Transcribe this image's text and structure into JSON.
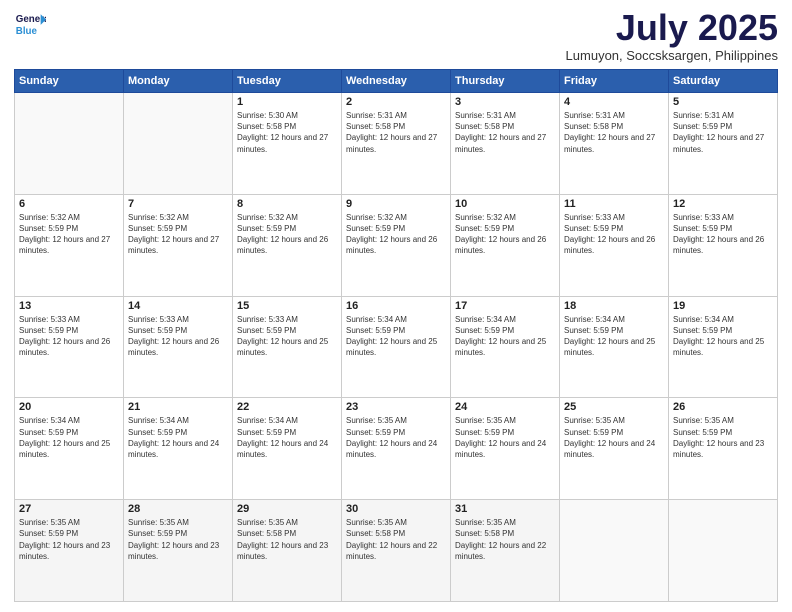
{
  "logo": {
    "line1": "General",
    "line2": "Blue"
  },
  "title": "July 2025",
  "location": "Lumuyon, Soccsksargen, Philippines",
  "days_header": [
    "Sunday",
    "Monday",
    "Tuesday",
    "Wednesday",
    "Thursday",
    "Friday",
    "Saturday"
  ],
  "weeks": [
    [
      {
        "day": "",
        "sunrise": "",
        "sunset": "",
        "daylight": ""
      },
      {
        "day": "",
        "sunrise": "",
        "sunset": "",
        "daylight": ""
      },
      {
        "day": "1",
        "sunrise": "Sunrise: 5:30 AM",
        "sunset": "Sunset: 5:58 PM",
        "daylight": "Daylight: 12 hours and 27 minutes."
      },
      {
        "day": "2",
        "sunrise": "Sunrise: 5:31 AM",
        "sunset": "Sunset: 5:58 PM",
        "daylight": "Daylight: 12 hours and 27 minutes."
      },
      {
        "day": "3",
        "sunrise": "Sunrise: 5:31 AM",
        "sunset": "Sunset: 5:58 PM",
        "daylight": "Daylight: 12 hours and 27 minutes."
      },
      {
        "day": "4",
        "sunrise": "Sunrise: 5:31 AM",
        "sunset": "Sunset: 5:58 PM",
        "daylight": "Daylight: 12 hours and 27 minutes."
      },
      {
        "day": "5",
        "sunrise": "Sunrise: 5:31 AM",
        "sunset": "Sunset: 5:59 PM",
        "daylight": "Daylight: 12 hours and 27 minutes."
      }
    ],
    [
      {
        "day": "6",
        "sunrise": "Sunrise: 5:32 AM",
        "sunset": "Sunset: 5:59 PM",
        "daylight": "Daylight: 12 hours and 27 minutes."
      },
      {
        "day": "7",
        "sunrise": "Sunrise: 5:32 AM",
        "sunset": "Sunset: 5:59 PM",
        "daylight": "Daylight: 12 hours and 27 minutes."
      },
      {
        "day": "8",
        "sunrise": "Sunrise: 5:32 AM",
        "sunset": "Sunset: 5:59 PM",
        "daylight": "Daylight: 12 hours and 26 minutes."
      },
      {
        "day": "9",
        "sunrise": "Sunrise: 5:32 AM",
        "sunset": "Sunset: 5:59 PM",
        "daylight": "Daylight: 12 hours and 26 minutes."
      },
      {
        "day": "10",
        "sunrise": "Sunrise: 5:32 AM",
        "sunset": "Sunset: 5:59 PM",
        "daylight": "Daylight: 12 hours and 26 minutes."
      },
      {
        "day": "11",
        "sunrise": "Sunrise: 5:33 AM",
        "sunset": "Sunset: 5:59 PM",
        "daylight": "Daylight: 12 hours and 26 minutes."
      },
      {
        "day": "12",
        "sunrise": "Sunrise: 5:33 AM",
        "sunset": "Sunset: 5:59 PM",
        "daylight": "Daylight: 12 hours and 26 minutes."
      }
    ],
    [
      {
        "day": "13",
        "sunrise": "Sunrise: 5:33 AM",
        "sunset": "Sunset: 5:59 PM",
        "daylight": "Daylight: 12 hours and 26 minutes."
      },
      {
        "day": "14",
        "sunrise": "Sunrise: 5:33 AM",
        "sunset": "Sunset: 5:59 PM",
        "daylight": "Daylight: 12 hours and 26 minutes."
      },
      {
        "day": "15",
        "sunrise": "Sunrise: 5:33 AM",
        "sunset": "Sunset: 5:59 PM",
        "daylight": "Daylight: 12 hours and 25 minutes."
      },
      {
        "day": "16",
        "sunrise": "Sunrise: 5:34 AM",
        "sunset": "Sunset: 5:59 PM",
        "daylight": "Daylight: 12 hours and 25 minutes."
      },
      {
        "day": "17",
        "sunrise": "Sunrise: 5:34 AM",
        "sunset": "Sunset: 5:59 PM",
        "daylight": "Daylight: 12 hours and 25 minutes."
      },
      {
        "day": "18",
        "sunrise": "Sunrise: 5:34 AM",
        "sunset": "Sunset: 5:59 PM",
        "daylight": "Daylight: 12 hours and 25 minutes."
      },
      {
        "day": "19",
        "sunrise": "Sunrise: 5:34 AM",
        "sunset": "Sunset: 5:59 PM",
        "daylight": "Daylight: 12 hours and 25 minutes."
      }
    ],
    [
      {
        "day": "20",
        "sunrise": "Sunrise: 5:34 AM",
        "sunset": "Sunset: 5:59 PM",
        "daylight": "Daylight: 12 hours and 25 minutes."
      },
      {
        "day": "21",
        "sunrise": "Sunrise: 5:34 AM",
        "sunset": "Sunset: 5:59 PM",
        "daylight": "Daylight: 12 hours and 24 minutes."
      },
      {
        "day": "22",
        "sunrise": "Sunrise: 5:34 AM",
        "sunset": "Sunset: 5:59 PM",
        "daylight": "Daylight: 12 hours and 24 minutes."
      },
      {
        "day": "23",
        "sunrise": "Sunrise: 5:35 AM",
        "sunset": "Sunset: 5:59 PM",
        "daylight": "Daylight: 12 hours and 24 minutes."
      },
      {
        "day": "24",
        "sunrise": "Sunrise: 5:35 AM",
        "sunset": "Sunset: 5:59 PM",
        "daylight": "Daylight: 12 hours and 24 minutes."
      },
      {
        "day": "25",
        "sunrise": "Sunrise: 5:35 AM",
        "sunset": "Sunset: 5:59 PM",
        "daylight": "Daylight: 12 hours and 24 minutes."
      },
      {
        "day": "26",
        "sunrise": "Sunrise: 5:35 AM",
        "sunset": "Sunset: 5:59 PM",
        "daylight": "Daylight: 12 hours and 23 minutes."
      }
    ],
    [
      {
        "day": "27",
        "sunrise": "Sunrise: 5:35 AM",
        "sunset": "Sunset: 5:59 PM",
        "daylight": "Daylight: 12 hours and 23 minutes."
      },
      {
        "day": "28",
        "sunrise": "Sunrise: 5:35 AM",
        "sunset": "Sunset: 5:59 PM",
        "daylight": "Daylight: 12 hours and 23 minutes."
      },
      {
        "day": "29",
        "sunrise": "Sunrise: 5:35 AM",
        "sunset": "Sunset: 5:58 PM",
        "daylight": "Daylight: 12 hours and 23 minutes."
      },
      {
        "day": "30",
        "sunrise": "Sunrise: 5:35 AM",
        "sunset": "Sunset: 5:58 PM",
        "daylight": "Daylight: 12 hours and 22 minutes."
      },
      {
        "day": "31",
        "sunrise": "Sunrise: 5:35 AM",
        "sunset": "Sunset: 5:58 PM",
        "daylight": "Daylight: 12 hours and 22 minutes."
      },
      {
        "day": "",
        "sunrise": "",
        "sunset": "",
        "daylight": ""
      },
      {
        "day": "",
        "sunrise": "",
        "sunset": "",
        "daylight": ""
      }
    ]
  ]
}
